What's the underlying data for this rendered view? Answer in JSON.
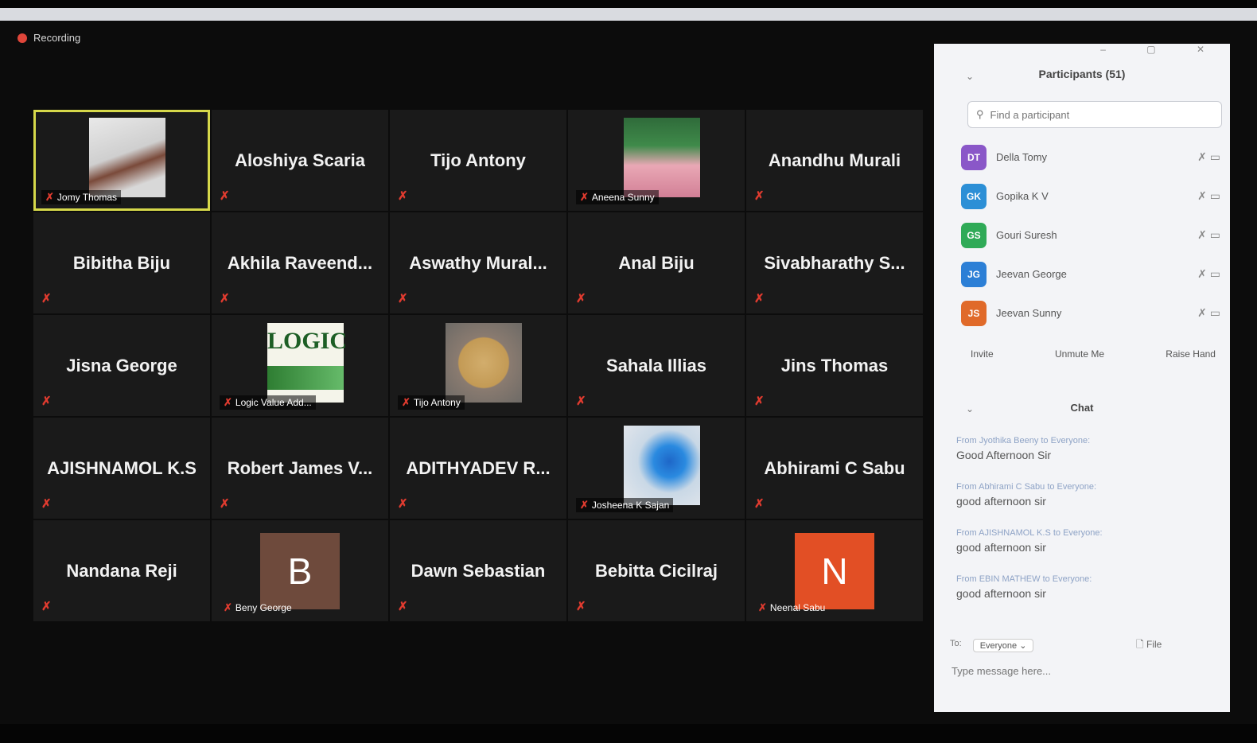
{
  "recording": {
    "label": "Recording"
  },
  "grid": {
    "tiles": [
      {
        "name": "Jomy Thomas",
        "type": "video",
        "pic": "doll"
      },
      {
        "name": "Aloshiya Scaria",
        "type": "name"
      },
      {
        "name": "Tijo Antony",
        "type": "name"
      },
      {
        "name": "Aneena Sunny",
        "type": "video",
        "pic": "girl"
      },
      {
        "name": "Anandhu Murali",
        "type": "name"
      },
      {
        "name": "Bibitha Biju",
        "type": "name"
      },
      {
        "name": "Akhila Raveend...",
        "type": "name"
      },
      {
        "name": "Aswathy Mural...",
        "type": "name"
      },
      {
        "name": "Anal Biju",
        "type": "name"
      },
      {
        "name": "Sivabharathy S...",
        "type": "name"
      },
      {
        "name": "Jisna George",
        "type": "name"
      },
      {
        "name": "Logic Value Add...",
        "type": "video",
        "pic": "logic"
      },
      {
        "name": "Tijo Antony",
        "type": "video",
        "pic": "biscuit"
      },
      {
        "name": "Sahala Illias",
        "type": "name"
      },
      {
        "name": "Jins Thomas",
        "type": "name"
      },
      {
        "name": "AJISHNAMOL K.S",
        "type": "name"
      },
      {
        "name": "Robert James V...",
        "type": "name"
      },
      {
        "name": "ADITHYADEV R...",
        "type": "name"
      },
      {
        "name": "Josheena K Sajan",
        "type": "video",
        "pic": "butterfly"
      },
      {
        "name": "Abhirami C Sabu",
        "type": "name"
      },
      {
        "name": "Nandana Reji",
        "type": "name"
      },
      {
        "name": "Beny George",
        "type": "avatar",
        "letter": "B",
        "color": "#6e4a3c"
      },
      {
        "name": "Dawn Sebastian",
        "type": "name"
      },
      {
        "name": "Bebitta Cicilraj",
        "type": "name"
      },
      {
        "name": "Neenal Sabu",
        "type": "avatar",
        "letter": "N",
        "color": "#e24f25"
      }
    ]
  },
  "logic_text": "LOGIC",
  "participants": {
    "title": "Participants (51)",
    "search_placeholder": "Find a participant",
    "items": [
      {
        "initials": "DT",
        "name": "Della Tomy",
        "color": "#8a57c8"
      },
      {
        "initials": "GK",
        "name": "Gopika K V",
        "color": "#2c8fd6"
      },
      {
        "initials": "GS",
        "name": "Gouri Suresh",
        "color": "#2faa57"
      },
      {
        "initials": "JG",
        "name": "Jeevan George",
        "color": "#2c7fd6"
      },
      {
        "initials": "JS",
        "name": "Jeevan Sunny",
        "color": "#e06a2a"
      }
    ],
    "buttons": [
      "Invite",
      "Unmute Me",
      "Raise Hand"
    ]
  },
  "chat": {
    "title": "Chat",
    "messages": [
      {
        "from": "From Jyothika Beeny to Everyone:",
        "text": "Good Afternoon Sir"
      },
      {
        "from": "From Abhirami C Sabu to Everyone:",
        "text": "good afternoon sir"
      },
      {
        "from": "From AJISHNAMOL K.S to Everyone:",
        "text": "good afternoon sir"
      },
      {
        "from": "From EBIN MATHEW to Everyone:",
        "text": "good afternoon sir"
      }
    ],
    "to_label": "To:",
    "to_value": "Everyone",
    "file_label": "File",
    "input_placeholder": "Type message here..."
  },
  "icons": {
    "mic_muted": "mic-muted-icon",
    "video_off": "video-off-icon",
    "search": "search-icon",
    "recording": "recording-dot-icon",
    "file": "file-icon"
  }
}
